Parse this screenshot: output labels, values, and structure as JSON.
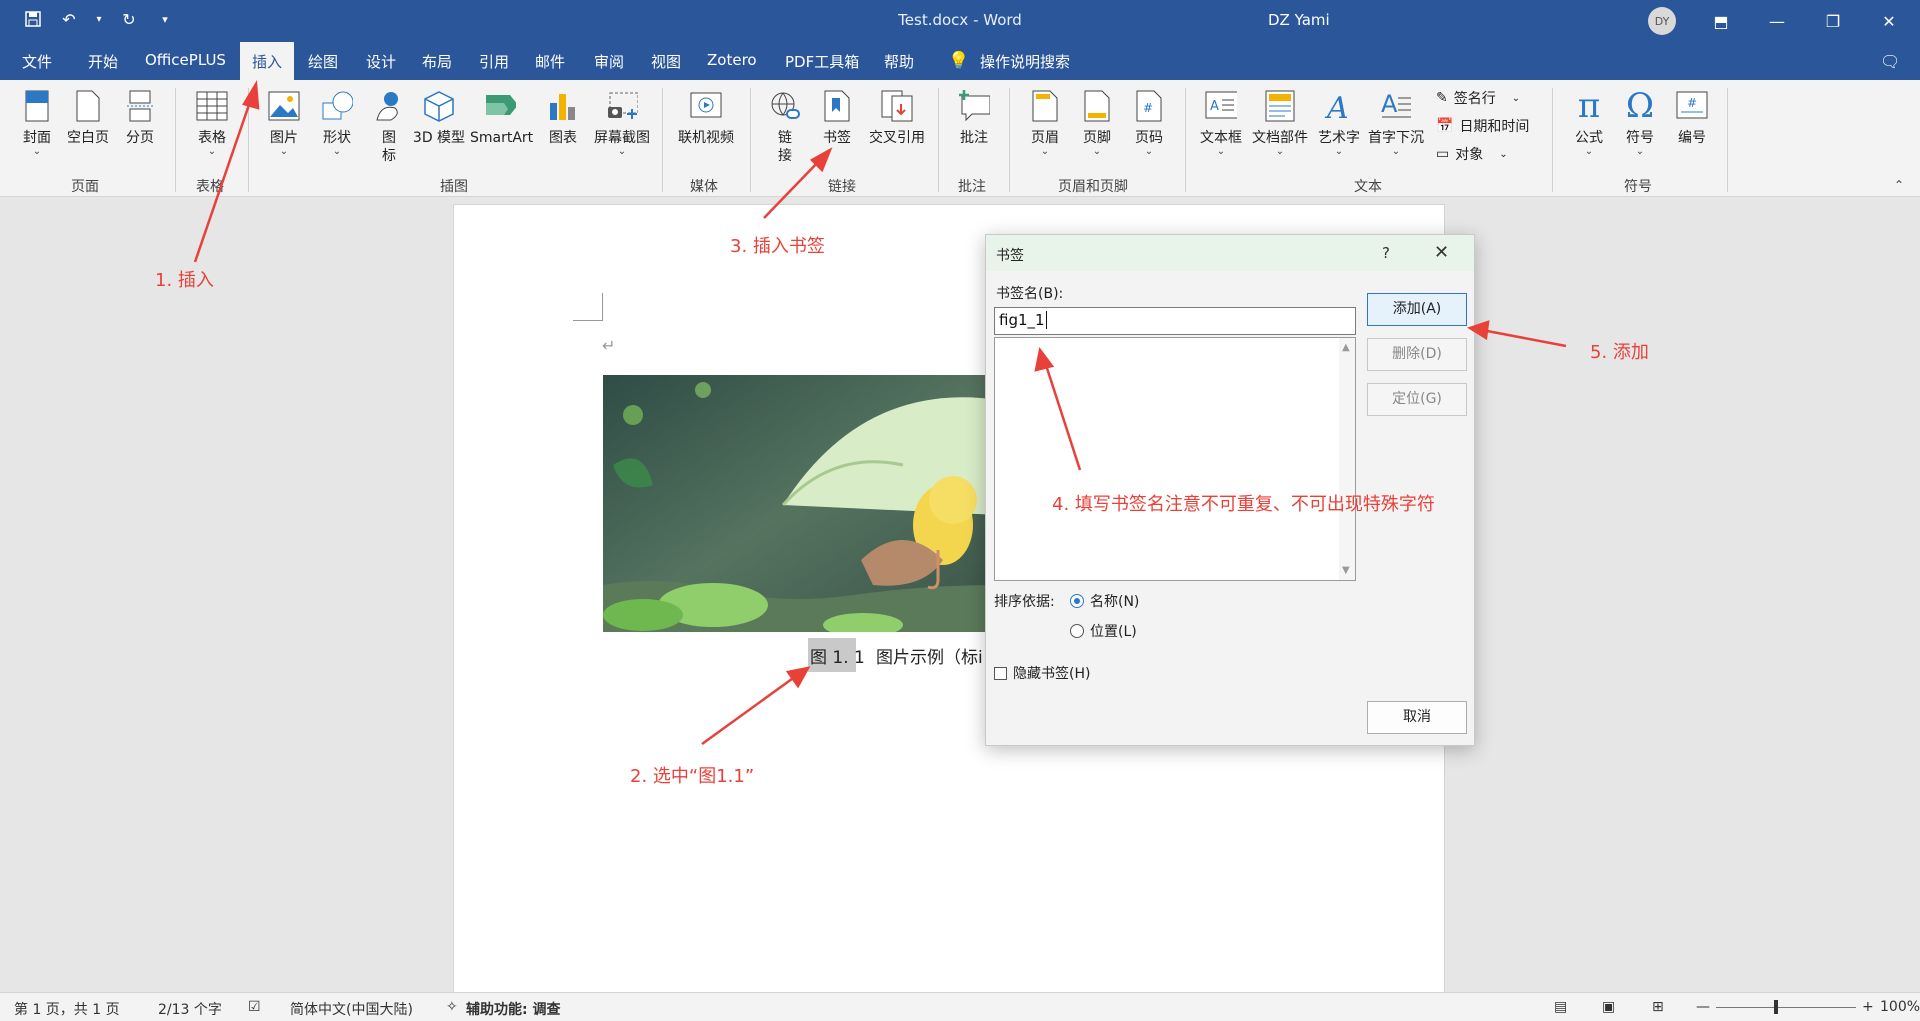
{
  "window": {
    "title": "Test.docx - Word",
    "user_name": "DZ Yami",
    "avatar_initials": "DY"
  },
  "menu": {
    "tabs": [
      "文件",
      "开始",
      "OfficePLUS",
      "插入",
      "绘图",
      "设计",
      "布局",
      "引用",
      "邮件",
      "审阅",
      "视图",
      "Zotero",
      "PDF工具箱",
      "帮助"
    ],
    "active_tab": "插入",
    "search": "操作说明搜索"
  },
  "ribbon": {
    "pages": {
      "cover": "封面",
      "blank": "空白页",
      "break": "分页",
      "group": "页面"
    },
    "tables": {
      "table": "表格",
      "group": "表格"
    },
    "illustrations": {
      "picture": "图片",
      "shape": "形状",
      "icon": "图标",
      "model3d": "3D 模型",
      "smartart": "SmartArt",
      "chart": "图表",
      "screenshot": "屏幕截图",
      "group": "插图"
    },
    "media": {
      "online_video": "联机视频",
      "group": "媒体"
    },
    "links": {
      "link": "链接",
      "bookmark": "书签",
      "crossref": "交叉引用",
      "group": "链接"
    },
    "comments": {
      "comment": "批注",
      "group": "批注"
    },
    "headerfooter": {
      "header": "页眉",
      "footer": "页脚",
      "pagenum": "页码",
      "group": "页眉和页脚"
    },
    "text": {
      "textbox": "文本框",
      "quickparts": "文档部件",
      "wordart": "艺术字",
      "dropcap": "首字下沉",
      "signature": "签名行",
      "datetime": "日期和时间",
      "object": "对象",
      "group": "文本"
    },
    "symbols": {
      "equation": "公式",
      "symbol": "符号",
      "number": "编号",
      "group": "符号"
    }
  },
  "document": {
    "caption_label": "图 1. 1",
    "caption_text": "图片示例（标i"
  },
  "dialog": {
    "title": "书签",
    "help": "?",
    "name_label": "书签名(B):",
    "name_value": "fig1_1",
    "add_button": "添加(A)",
    "delete_button": "删除(D)",
    "goto_button": "定位(G)",
    "sort_label": "排序依据:",
    "sort_name": "名称(N)",
    "sort_position": "位置(L)",
    "hidden_label": "隐藏书签(H)",
    "cancel_button": "取消"
  },
  "annotations": {
    "step1": "1. 插入",
    "step2": "2. 选中“图1.1”",
    "step3": "3. 插入书签",
    "step4": "4. 填写书签名注意不可重复、不可出现特殊字符",
    "step5": "5. 添加"
  },
  "status": {
    "page": "第 1 页，共 1 页",
    "words": "2/13 个字",
    "language": "简体中文(中国大陆)",
    "accessibility": "辅助功能: 调查",
    "zoom": "100%"
  },
  "colors": {
    "title_bar": "#2b579a",
    "annotation": "#e8413a",
    "accent": "#2b78c5"
  }
}
